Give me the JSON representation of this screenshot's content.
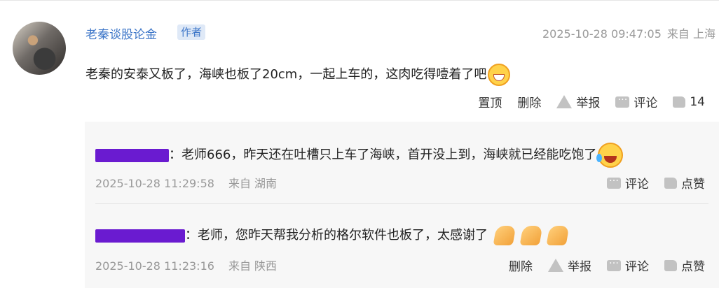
{
  "post": {
    "author": "老秦谈股论金",
    "author_badge": "作者",
    "timestamp": "2025-10-28 09:47:05",
    "source": "来自 上海",
    "text": "老秦的安泰又板了，海峡也板了20cm，一起上车的，这肉吃得噎着了吧",
    "actions": {
      "pin": "置顶",
      "delete": "删除",
      "report": "举报",
      "comment": "评论",
      "likes": "14"
    }
  },
  "replies": [
    {
      "text": "：老师666，昨天还在吐槽只上车了海峡，首开没上到，海峡就已经能吃饱了",
      "timestamp": "2025-10-28 11:29:58",
      "source": "来自 湖南",
      "actions": {
        "comment": "评论",
        "like": "点赞"
      }
    },
    {
      "text": "：老师，您昨天帮我分析的格尔软件也板了，太感谢了",
      "timestamp": "2025-10-28 11:23:16",
      "source": "来自 陕西",
      "actions": {
        "delete": "删除",
        "report": "举报",
        "comment": "评论",
        "like": "点赞"
      }
    }
  ],
  "colors": {
    "link_blue": "#3d76c8",
    "redaction_purple": "#6a1bd0",
    "muted_gray": "#999999",
    "reply_bg": "#f7f7f7"
  },
  "icons": [
    "grin-emoji",
    "warning-icon",
    "comment-icon",
    "thumbs-up-icon",
    "laugh-tears-emoji",
    "clap-emoji"
  ]
}
